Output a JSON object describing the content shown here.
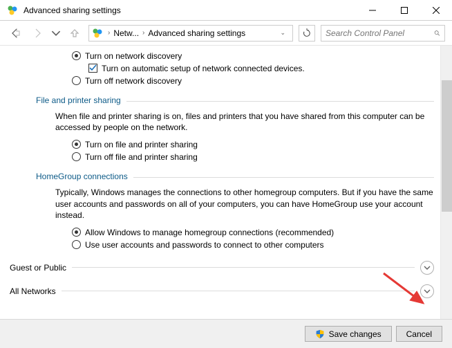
{
  "window": {
    "title": "Advanced sharing settings"
  },
  "breadcrumb": {
    "item1": "Netw...",
    "item2": "Advanced sharing settings"
  },
  "search": {
    "placeholder": "Search Control Panel"
  },
  "network_discovery": {
    "turn_on": "Turn on network discovery",
    "auto_setup": "Turn on automatic setup of network connected devices.",
    "turn_off": "Turn off network discovery"
  },
  "file_printer": {
    "header": "File and printer sharing",
    "desc": "When file and printer sharing is on, files and printers that you have shared from this computer can be accessed by people on the network.",
    "turn_on": "Turn on file and printer sharing",
    "turn_off": "Turn off file and printer sharing"
  },
  "homegroup": {
    "header": "HomeGroup connections",
    "desc": "Typically, Windows manages the connections to other homegroup computers. But if you have the same user accounts and passwords on all of your computers, you can have HomeGroup use your account instead.",
    "allow": "Allow Windows to manage homegroup connections (recommended)",
    "use_accounts": "Use user accounts and passwords to connect to other computers"
  },
  "profiles": {
    "guest": "Guest or Public",
    "all": "All Networks"
  },
  "footer": {
    "save": "Save changes",
    "cancel": "Cancel"
  }
}
